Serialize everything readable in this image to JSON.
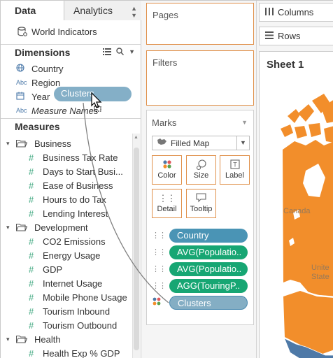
{
  "left_pane": {
    "tabs": {
      "data": "Data",
      "analytics": "Analytics"
    },
    "datasource": "World Indicators",
    "dimensions_title": "Dimensions",
    "measures_title": "Measures",
    "dimensions": [
      {
        "type": "globe",
        "name": "Country"
      },
      {
        "type": "Abc",
        "name": "Region"
      },
      {
        "type": "calendar",
        "name": "Year"
      },
      {
        "type": "Abc",
        "name": "Measure Names"
      }
    ],
    "measures": {
      "business": {
        "label": "Business",
        "items": [
          "Business Tax Rate",
          "Days to Start Busi...",
          "Ease of Business",
          "Hours to do Tax",
          "Lending Interest"
        ]
      },
      "development": {
        "label": "Development",
        "items": [
          "CO2 Emissions",
          "Energy Usage",
          "GDP",
          "Internet Usage",
          "Mobile Phone Usage",
          "Tourism Inbound",
          "Tourism Outbound"
        ]
      },
      "health": {
        "label": "Health",
        "items": [
          "Health Exp % GDP"
        ]
      }
    }
  },
  "drag_ghost": "Clusters",
  "shelves": {
    "pages": "Pages",
    "filters": "Filters",
    "columns": "Columns",
    "rows": "Rows"
  },
  "marks": {
    "title": "Marks",
    "mark_type": "Filled Map",
    "buttons": {
      "color": "Color",
      "size": "Size",
      "label": "Label",
      "detail": "Detail",
      "tooltip": "Tooltip"
    },
    "pills": [
      "Country",
      "AVG(Populatio..",
      "AVG(Populatio..",
      "AGG(TouringP..",
      "Clusters"
    ]
  },
  "sheet": {
    "title": "Sheet 1",
    "label_canada": "Canada",
    "label_united": "Unite",
    "label_states": "State"
  },
  "colors": {
    "orange": "#f28e2b",
    "blue": "#4e79a7",
    "green": "#17a673",
    "pill_blue": "#4a94b5"
  }
}
